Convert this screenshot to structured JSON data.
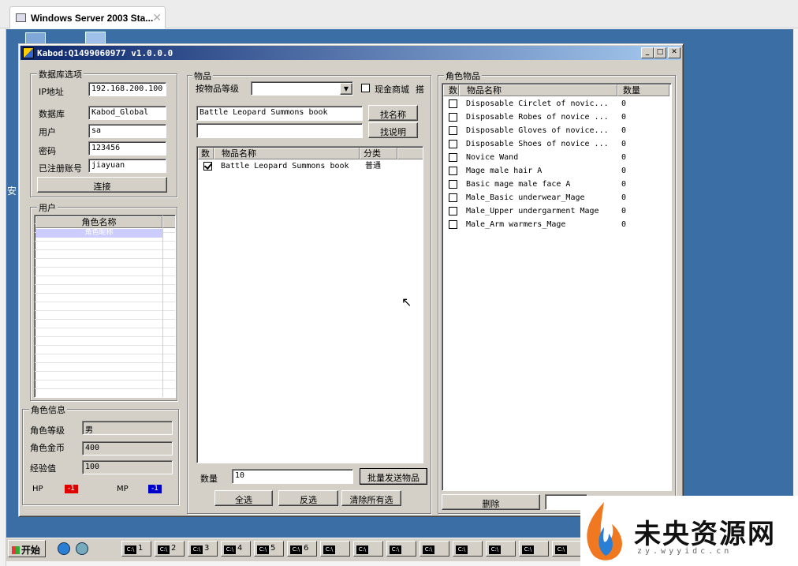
{
  "browser": {
    "tab_title": "Windows Server 2003 Sta...",
    "tab_close": "✕"
  },
  "desktop": {
    "left_text": "安"
  },
  "app": {
    "title": "Kabod:Q1499060977 v1.0.0.0",
    "minimize": "_",
    "maximize": "□",
    "close": "✕"
  },
  "db": {
    "group_label": "数据库选项",
    "ip_label": "IP地址",
    "ip_value": "192.168.200.100",
    "db_label": "数据库",
    "db_value": "Kabod_Global",
    "user_label": "用户",
    "user_value": "sa",
    "password_label": "密码",
    "password_value": "123456",
    "account_label": "已注册账号",
    "account_value": "jiayuan",
    "connect_button": "连接"
  },
  "users": {
    "group_label": "用户",
    "column_header": "角色名称",
    "selected_row": "角色昵称"
  },
  "charinfo": {
    "group_label": "角色信息",
    "level_label": "角色等级",
    "level_value": "男",
    "gold_label": "角色金币",
    "gold_value": "400",
    "exp_label": "经验值",
    "exp_value": "100",
    "hp_label": "HP",
    "hp_value": "-1",
    "mp_label": "MP",
    "mp_value": "-1"
  },
  "items": {
    "group_label": "物品",
    "grade_label": "按物品等级",
    "grade_value": "",
    "cash_shop_label": "现金商城",
    "cash_shop_checked": false,
    "cash_shop_extra": "搭",
    "search_name_value": "Battle Leopard Summons book",
    "search_name_button": "找名称",
    "search_desc_value": "",
    "search_desc_button": "找说明",
    "columns": [
      "数",
      "物品名称",
      "分类"
    ],
    "rows": [
      {
        "checked": true,
        "name": "Battle Leopard Summons book",
        "category": "普通"
      }
    ],
    "quantity_label": "数量",
    "quantity_value": "10",
    "batch_send_button": "批量发送物品",
    "select_all_button": "全选",
    "invert_button": "反选",
    "clear_all_button": "清除所有选"
  },
  "char_items": {
    "group_label": "角色物品",
    "columns": [
      "数",
      "物品名称",
      "数量"
    ],
    "rows": [
      {
        "name": "Disposable Circlet of novic...",
        "qty": "0"
      },
      {
        "name": "Disposable Robes of novice ...",
        "qty": "0"
      },
      {
        "name": "Disposable Gloves of novice...",
        "qty": "0"
      },
      {
        "name": "Disposable Shoes of novice ...",
        "qty": "0"
      },
      {
        "name": "Novice Wand",
        "qty": "0"
      },
      {
        "name": "Mage male hair A",
        "qty": "0"
      },
      {
        "name": "Basic mage male face A",
        "qty": "0"
      },
      {
        "name": "Male_Basic underwear_Mage",
        "qty": "0"
      },
      {
        "name": "Male_Upper undergarment Mage",
        "qty": "0"
      },
      {
        "name": "Male_Arm warmers_Mage",
        "qty": "0"
      }
    ],
    "delete_button": "删除"
  },
  "taskbar": {
    "start_label": "开始",
    "buttons": [
      "1",
      "2",
      "3",
      "4",
      "5",
      "6",
      "",
      "",
      "",
      "",
      "",
      "",
      "",
      ""
    ]
  },
  "watermark": {
    "text": "未央资源网",
    "url": "zy.wyyidc.cn"
  },
  "colors": {
    "desktop": "#3a6ea5",
    "titlebar_start": "#0a246a",
    "hp": "#e00000",
    "mp": "#0000cc",
    "selection": "#ccccff"
  }
}
